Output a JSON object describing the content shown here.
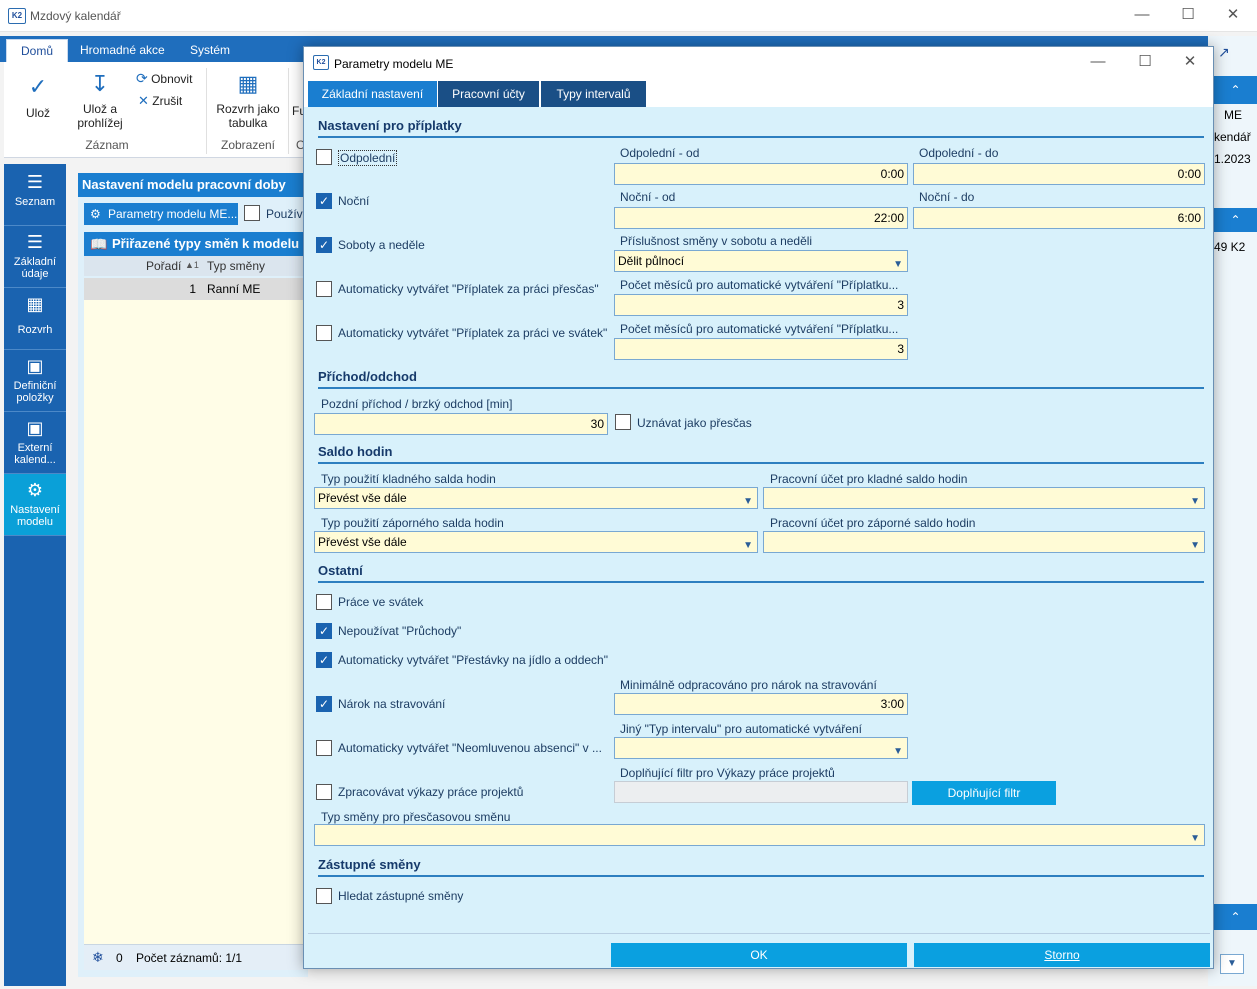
{
  "app": {
    "title": "Mzdový kalendář"
  },
  "ribbon": {
    "tabs": [
      "Domů",
      "Hromadné akce",
      "Systém"
    ],
    "save": "Ulož",
    "save_view_1": "Ulož a",
    "save_view_2": "prohlížej",
    "refresh": "Obnovit",
    "cancel": "Zrušit",
    "group_record": "Záznam",
    "schedule_1": "Rozvrh jako",
    "schedule_2": "tabulka",
    "group_display": "Zobrazení",
    "cut_fu": "Fu",
    "cut_o": "O"
  },
  "nav": {
    "items": [
      {
        "label_1": "Seznam",
        "label_2": ""
      },
      {
        "label_1": "Základní",
        "label_2": "údaje"
      },
      {
        "label_1": "Rozvrh",
        "label_2": ""
      },
      {
        "label_1": "Definiční",
        "label_2": "položky"
      },
      {
        "label_1": "Externí",
        "label_2": "kalend..."
      },
      {
        "label_1": "Nastavení",
        "label_2": "modelu"
      }
    ]
  },
  "panel": {
    "title": "Nastavení modelu pracovní doby",
    "param_button": "Parametry modelu ME...",
    "use_label": "Použív",
    "subtitle": "Přiřazené typy směn k modelu",
    "col_order": "Pořadí",
    "col_type": "Typ směny",
    "row_order": "1",
    "row_type": "Ranní ME",
    "status_count": "0",
    "status_records": "Počet záznamů: 1/1"
  },
  "right": {
    "t1": "ME",
    "t2": "kendář",
    "t3": "1.2023",
    "t4": "49 K2"
  },
  "dialog": {
    "title": "Parametry modelu ME",
    "tabs": [
      "Základní nastavení",
      "Pracovní účty",
      "Typy intervalů"
    ],
    "sec_premium": "Nastavení pro příplatky",
    "afternoon": "Odpolední",
    "afternoon_from_label": "Odpolední - od",
    "afternoon_from": "0:00",
    "afternoon_to_label": "Odpolední - do",
    "afternoon_to": "0:00",
    "night": "Noční",
    "night_from_label": "Noční - od",
    "night_from": "22:00",
    "night_to_label": "Noční - do",
    "night_to": "6:00",
    "weekend": "Soboty a neděle",
    "weekend_assign_label": "Příslušnost směny v sobotu a neděli",
    "weekend_assign": "Dělit půlnocí",
    "auto_overtime": "Automaticky vytvářet \"Příplatek za práci přesčas\"",
    "auto_overtime_months_label": "Počet měsíců pro automatické vytváření \"Příplatku...",
    "auto_overtime_months": "3",
    "auto_holiday": "Automaticky vytvářet \"Příplatek za práci ve svátek\"",
    "auto_holiday_months_label": "Počet měsíců pro automatické vytváření \"Příplatku...",
    "auto_holiday_months": "3",
    "sec_arrival": "Příchod/odchod",
    "late_label": "Pozdní příchod / brzký odchod [min]",
    "late_value": "30",
    "accept_overtime": "Uznávat jako přesčas",
    "sec_balance": "Saldo hodin",
    "pos_type_label": "Typ použití kladného salda hodin",
    "pos_type": "Převést vše dále",
    "pos_account_label": "Pracovní účet pro kladné saldo hodin",
    "pos_account": "",
    "neg_type_label": "Typ použití záporného salda hodin",
    "neg_type": "Převést vše dále",
    "neg_account_label": "Pracovní účet pro záporné saldo hodin",
    "neg_account": "",
    "sec_other": "Ostatní",
    "holiday_work": "Práce ve svátek",
    "no_passages": "Nepoužívat \"Průchody\"",
    "auto_breaks": "Automaticky vytvářet \"Přestávky na jídlo a oddech\"",
    "meal_min_label": "Minimálně odpracováno pro nárok na stravování",
    "meal": "Nárok na stravování",
    "meal_min": "3:00",
    "auto_absence": "Automaticky vytvářet \"Neomluvenou absenci\" v ...",
    "interval_type_label": "Jiný \"Typ intervalu\" pro automatické vytváření",
    "interval_type": "",
    "projects": "Zpracovávat výkazy práce projektů",
    "project_filter_label": "Doplňující filtr pro Výkazy práce projektů",
    "project_filter": "",
    "project_filter_button": "Doplňující filtr",
    "overtime_shift_label": "Typ směny pro přesčasovou směnu",
    "overtime_shift": "",
    "sec_substitute": "Zástupné směny",
    "find_substitute": "Hledat zástupné směny",
    "ok": "OK",
    "storno": "Storno"
  }
}
